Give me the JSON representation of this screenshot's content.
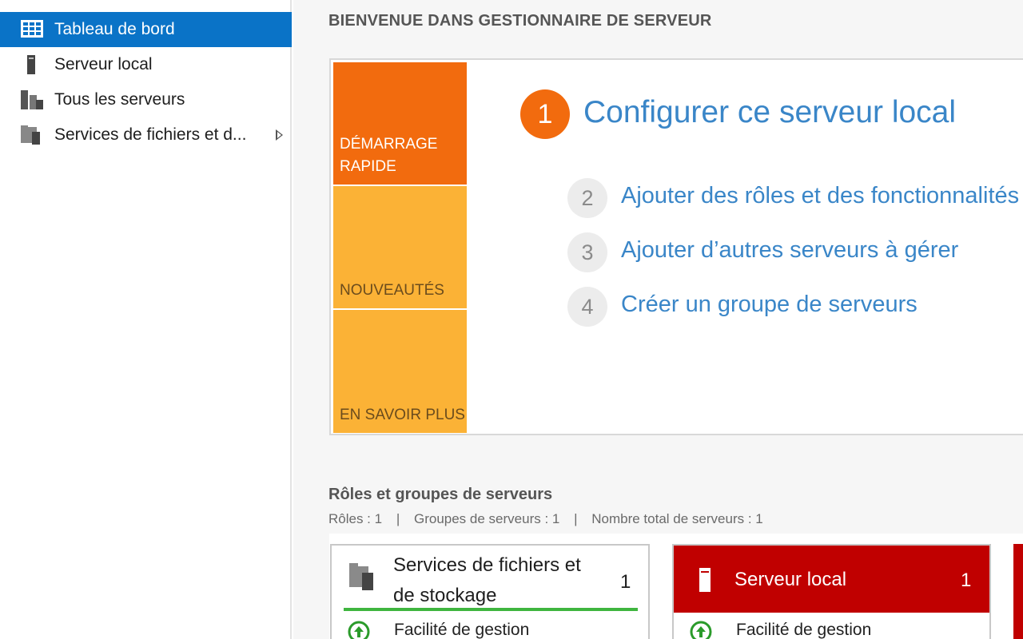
{
  "sidebar": {
    "items": [
      {
        "label": "Tableau de bord",
        "icon": "dashboard-icon",
        "active": true
      },
      {
        "label": "Serveur local",
        "icon": "server-icon"
      },
      {
        "label": "Tous les serveurs",
        "icon": "all-servers-icon"
      },
      {
        "label": "Services de fichiers et d...",
        "icon": "file-services-icon",
        "expandable": true
      }
    ]
  },
  "main": {
    "welcome_title": "BIENVENUE DANS GESTIONNAIRE DE SERVEUR",
    "tiles": [
      {
        "label": "DÉMARRAGE RAPIDE"
      },
      {
        "label": "NOUVEAUTÉS"
      },
      {
        "label": "EN SAVOIR PLUS"
      }
    ],
    "steps": [
      {
        "number": "1",
        "label": "Configurer ce serveur local"
      },
      {
        "number": "2",
        "label": "Ajouter des rôles et des fonctionnalités"
      },
      {
        "number": "3",
        "label": "Ajouter d’autres serveurs à gérer"
      },
      {
        "number": "4",
        "label": "Créer un groupe de serveurs"
      }
    ],
    "roles": {
      "title": "Rôles et groupes de serveurs",
      "summary": {
        "roles": "Rôles : 1",
        "groups": "Groupes de serveurs : 1",
        "total": "Nombre total de serveurs : 1"
      },
      "cards": [
        {
          "title_line1": "Services de fichiers et",
          "title_line2": "de stockage",
          "count": "1",
          "status": "Facilité de gestion"
        },
        {
          "title": "Serveur local",
          "count": "1",
          "status": "Facilité de gestion"
        }
      ]
    }
  },
  "colors": {
    "nav_active": "#0a73c7",
    "tile_orange": "#f26b0e",
    "tile_amber": "#fbb236",
    "link_blue": "#3a86c8",
    "alert_red": "#c00000",
    "ok_green": "#3fb53f"
  }
}
